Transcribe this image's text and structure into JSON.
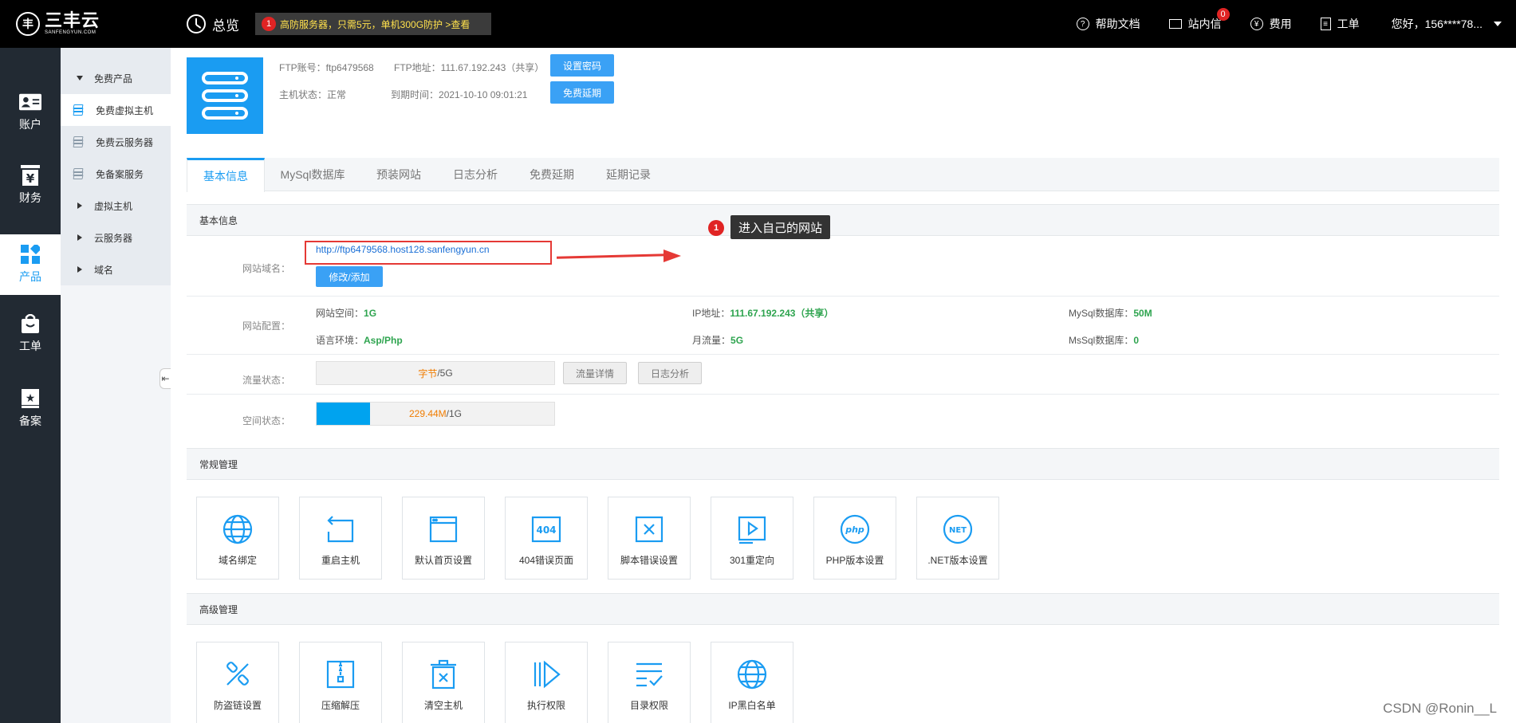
{
  "topbar": {
    "logo_cn": "三丰云",
    "logo_en": "SANFENGYUN.COM",
    "overview": "总览",
    "promo_num": "1",
    "promo": "高防服务器，只需5元，单机300G防护 >查看",
    "help": "帮助文档",
    "messages": "站内信",
    "messages_badge": "0",
    "fees": "费用",
    "tickets": "工单",
    "greeting": "您好，156****78..."
  },
  "leftnav": {
    "items": [
      {
        "label": "账户",
        "icon": "id-card-icon"
      },
      {
        "label": "财务",
        "icon": "yuan-icon"
      },
      {
        "label": "产品",
        "icon": "grid-icon"
      },
      {
        "label": "工单",
        "icon": "bag-icon"
      },
      {
        "label": "备案",
        "icon": "star-doc-icon"
      }
    ]
  },
  "submenu": {
    "free_products": "免费产品",
    "free_vhost": "免费虚拟主机",
    "free_cloud": "免费云服务器",
    "free_icp": "免备案服务",
    "vhost": "虚拟主机",
    "cloud": "云服务器",
    "domain": "域名"
  },
  "host": {
    "ftp_account_label": "FTP账号：",
    "ftp_account": "ftp6479568",
    "ftp_addr_label": "FTP地址：",
    "ftp_addr": "111.67.192.243（共享）",
    "status_label": "主机状态：",
    "status": "正常",
    "expire_label": "到期时间：",
    "expire": "2021-10-10 09:01:21",
    "btn_set_pwd": "设置密码",
    "btn_extend": "免费延期"
  },
  "tabs": [
    "基本信息",
    "MySql数据库",
    "预装网站",
    "日志分析",
    "免费延期",
    "延期记录"
  ],
  "basic": {
    "section": "基本信息",
    "domain_label": "网站域名：",
    "domain_link": "http://ftp6479568.host128.sanfengyun.cn",
    "btn_modify": "修改/添加",
    "tip_num": "1",
    "tip": "进入自己的网站",
    "config_label": "网站配置：",
    "space_k": "网站空间：",
    "space_v": "1G",
    "ip_k": "IP地址：",
    "ip_v": "111.67.192.243（共享）",
    "mysql_k": "MySql数据库：",
    "mysql_v": "50M",
    "lang_k": "语言环境：",
    "lang_v": "Asp/Php",
    "traffic_k": "月流量：",
    "traffic_v": "5G",
    "mssql_k": "MsSql数据库：",
    "mssql_v": "0",
    "traffic_label": "流量状态：",
    "traffic_used": "字节",
    "traffic_total": "/5G",
    "traffic_fraction": 0,
    "btn_traffic_detail": "流量详情",
    "btn_log": "日志分析",
    "space_label": "空间状态：",
    "space_used": "229.44M",
    "space_total": "/1G",
    "space_fraction": 0.224
  },
  "regular": {
    "section": "常规管理",
    "tiles": [
      "域名绑定",
      "重启主机",
      "默认首页设置",
      "404错误页面",
      "脚本错误设置",
      "301重定向",
      "PHP版本设置",
      ".NET版本设置"
    ]
  },
  "advanced": {
    "section": "高级管理",
    "tiles": [
      "防盗链设置",
      "压缩解压",
      "清空主机",
      "执行权限",
      "目录权限",
      "IP黑白名单"
    ]
  },
  "watermark": "CSDN @Ronin__L",
  "colors": {
    "accent": "#1a9cf2",
    "topbar": "#000000",
    "leftnav": "#222a33",
    "green": "#2ea44f",
    "red": "#e53935"
  }
}
